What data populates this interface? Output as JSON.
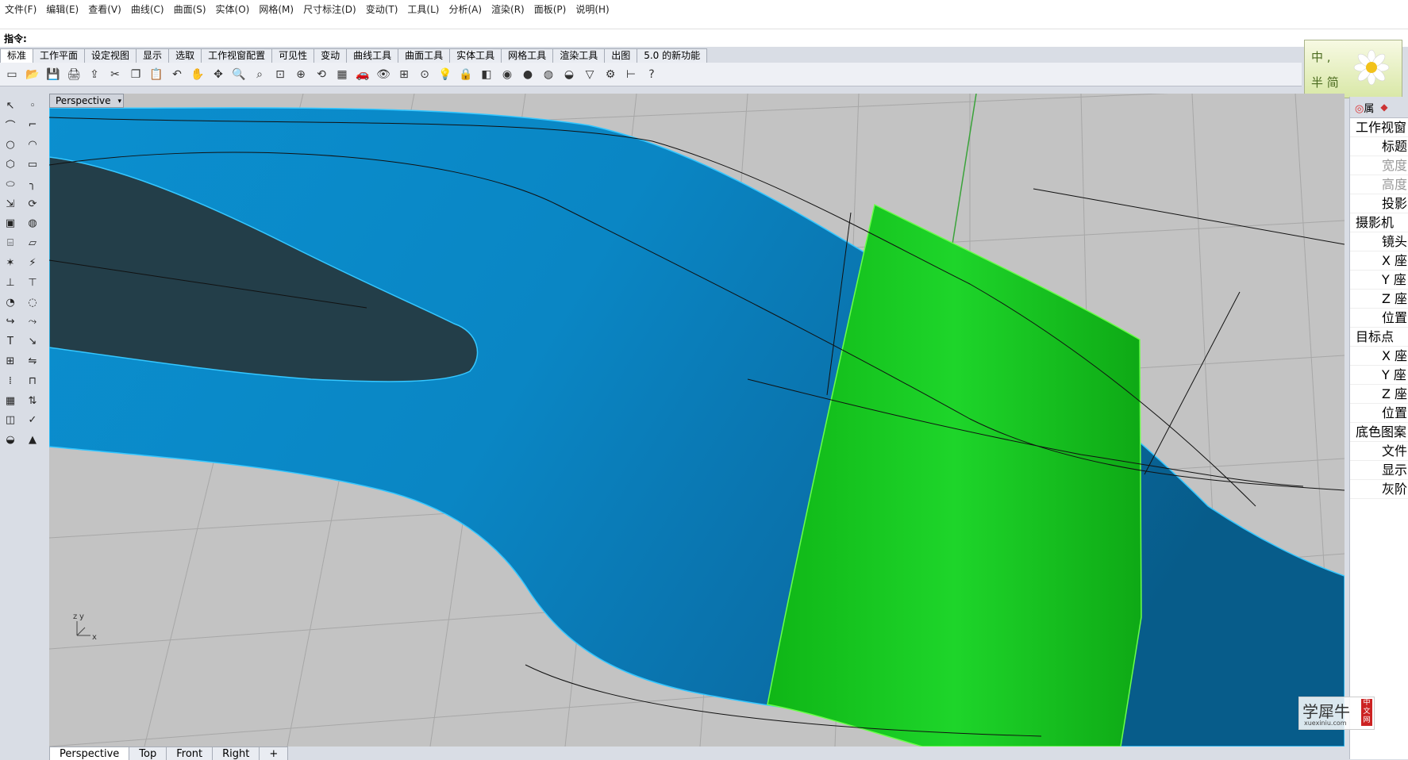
{
  "menu": [
    "文件(F)",
    "编辑(E)",
    "查看(V)",
    "曲线(C)",
    "曲面(S)",
    "实体(O)",
    "网格(M)",
    "尺寸标注(D)",
    "变动(T)",
    "工具(L)",
    "分析(A)",
    "渲染(R)",
    "面板(P)",
    "说明(H)"
  ],
  "command": {
    "label": "指令:"
  },
  "toolbar_tabs": [
    "标准",
    "工作平面",
    "设定视图",
    "显示",
    "选取",
    "工作视窗配置",
    "可见性",
    "变动",
    "曲线工具",
    "曲面工具",
    "实体工具",
    "网格工具",
    "渲染工具",
    "出图",
    "5.0 的新功能"
  ],
  "toolbar_icons": [
    "new-file-icon",
    "open-folder-icon",
    "save-icon",
    "print-icon",
    "import-icon",
    "cut-icon",
    "copy-icon",
    "paste-icon",
    "undo-icon",
    "pan-hand-icon",
    "move-view-icon",
    "zoom-icon",
    "zoom-window-icon",
    "zoom-extents-icon",
    "zoom-selected-icon",
    "rotate-view-icon",
    "four-view-icon",
    "car-icon",
    "eye-icon",
    "grid-icon",
    "snap-icon",
    "light-icon",
    "lock-icon",
    "layer-icon",
    "color-wheel-icon",
    "shade-icon",
    "render-sphere-icon",
    "blue-sphere-icon",
    "filter-icon",
    "settings-gear-icon",
    "dimension-icon",
    "help-icon"
  ],
  "logo": {
    "line1": "中 ,",
    "line2": "半 简"
  },
  "left_tools": [
    "select-arrow-icon",
    "point-icon",
    "polyline-icon",
    "curve-edit-icon",
    "circle-icon",
    "arc-icon",
    "polygon-icon",
    "rectangle-icon",
    "ellipse-icon",
    "fillet-icon",
    "transform-icon",
    "revolve-icon",
    "box-icon",
    "sphere-icon",
    "cylinder-icon",
    "plane-icon",
    "explode-icon",
    "boolean-icon",
    "trim-icon",
    "split-icon",
    "join-icon",
    "network-icon",
    "offset-icon",
    "blend-icon",
    "text-icon",
    "dimension-icon",
    "array-icon",
    "mirror-icon",
    "mesh-icon",
    "extrude-icon",
    "grid-array-icon",
    "align-icon",
    "surface-icon",
    "check-icon",
    "render-icon",
    "paint-icon"
  ],
  "viewport": {
    "title": "Perspective",
    "axis_x": "x",
    "axis_y": "y",
    "axis_z": "z"
  },
  "viewport_tabs": [
    "Perspective",
    "Top",
    "Front",
    "Right",
    "+"
  ],
  "right_panel": {
    "tabs": [
      "属"
    ],
    "rows": [
      {
        "text": "工作视窗",
        "indent": false,
        "grey": false
      },
      {
        "text": "标题",
        "indent": true,
        "grey": false
      },
      {
        "text": "宽度",
        "indent": true,
        "grey": true
      },
      {
        "text": "高度",
        "indent": true,
        "grey": true
      },
      {
        "text": "投影",
        "indent": true,
        "grey": false
      },
      {
        "text": "摄影机",
        "indent": false,
        "grey": false
      },
      {
        "text": "镜头",
        "indent": true,
        "grey": false
      },
      {
        "text": "X 座",
        "indent": true,
        "grey": false
      },
      {
        "text": "Y 座",
        "indent": true,
        "grey": false
      },
      {
        "text": "Z 座",
        "indent": true,
        "grey": false
      },
      {
        "text": "位置",
        "indent": true,
        "grey": false
      },
      {
        "text": "目标点",
        "indent": false,
        "grey": false
      },
      {
        "text": "X 座",
        "indent": true,
        "grey": false
      },
      {
        "text": "Y 座",
        "indent": true,
        "grey": false
      },
      {
        "text": "Z 座",
        "indent": true,
        "grey": false
      },
      {
        "text": "位置",
        "indent": true,
        "grey": false
      },
      {
        "text": "底色图案",
        "indent": false,
        "grey": false
      },
      {
        "text": "文件",
        "indent": true,
        "grey": false
      },
      {
        "text": "显示",
        "indent": true,
        "grey": false
      },
      {
        "text": "灰阶",
        "indent": true,
        "grey": false
      }
    ]
  },
  "watermark": {
    "text": "学犀牛",
    "sub": "xuexiniu.com",
    "badge": "中文网"
  },
  "colors": {
    "surface_blue": "#0a7bb8",
    "surface_green": "#16c21c",
    "background": "#c3c3c3"
  }
}
